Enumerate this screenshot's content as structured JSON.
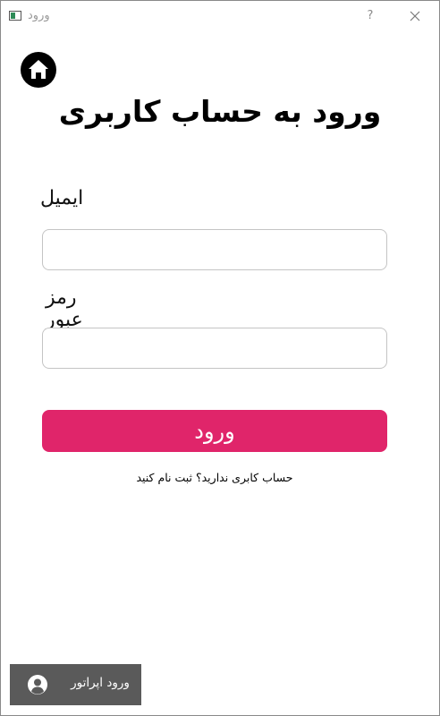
{
  "window": {
    "title": "ورود",
    "help_symbol": "?"
  },
  "page": {
    "heading": "ورود به حساب کاربری"
  },
  "form": {
    "email_label": "ایمیل",
    "email_value": "",
    "password_label": "رمز عبور",
    "password_value": "",
    "submit_label": "ورود"
  },
  "register_link": "حساب کابری ندارید؟ ثبت نام کنید",
  "operator_button": {
    "label": "ورود اپراتور",
    "icon": "user-circle-icon"
  },
  "icons": {
    "home": "home-icon",
    "close": "close-icon",
    "app": "window-app-icon"
  },
  "colors": {
    "primary": "#e0256a",
    "operator_bg": "#5a5a5a",
    "field_border": "#c4c4c4"
  }
}
